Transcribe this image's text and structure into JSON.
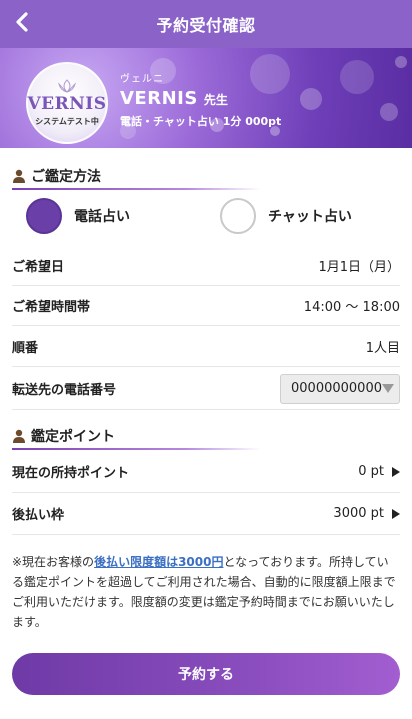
{
  "header": {
    "title": "予約受付確認",
    "back_icon": "chevron-left-icon"
  },
  "banner": {
    "avatar": {
      "brand": "VERNIS",
      "sub": "システムテスト中",
      "emblem_icon": "lotus-icon"
    },
    "kana_name": "ヴェルニ",
    "name": "VERNIS",
    "honorific": "先生",
    "rate": "電話・チャット占い 1分 000pt"
  },
  "method_section": {
    "heading": "ご鑑定方法",
    "options": [
      {
        "label": "電話占い",
        "selected": true
      },
      {
        "label": "チャット占い",
        "selected": false
      }
    ]
  },
  "details": {
    "date": {
      "label": "ご希望日",
      "value": "1月1日（月）"
    },
    "time": {
      "label": "ご希望時間帯",
      "value": "14:00 〜 18:00"
    },
    "order": {
      "label": "順番",
      "value": "1人目"
    },
    "phone": {
      "label": "転送先の電話番号",
      "value": "00000000000"
    }
  },
  "points_section": {
    "heading": "鑑定ポイント",
    "current": {
      "label": "現在の所持ポイント",
      "value": "0 pt"
    },
    "deferred": {
      "label": "後払い枠",
      "value": "3000 pt"
    }
  },
  "note": {
    "prefix": "※現在お客様の",
    "link": "後払い限度額は3000円",
    "suffix": "となっております。所持している鑑定ポイントを超過してご利用された場合、自動的に限度額上限までご利用いただけます。限度額の変更は鑑定予約時間までにお願いいたします。"
  },
  "submit": {
    "label": "予約する"
  },
  "colors": {
    "header": "#8a62c8",
    "accent": "#6b3fa8",
    "link": "#3b6fc2"
  }
}
